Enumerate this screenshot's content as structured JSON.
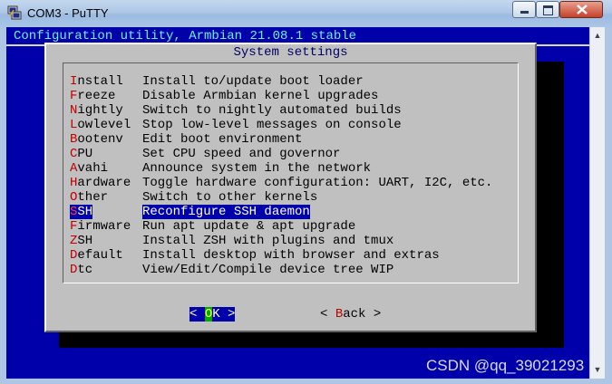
{
  "window": {
    "title": "COM3 - PuTTY",
    "icon": "putty-icon",
    "controls": [
      "minimize-icon",
      "maximize-icon",
      "close-icon"
    ]
  },
  "terminal": {
    "header": "Configuration utility, Armbian 21.08.1 stable",
    "background_color": "#0000aa"
  },
  "dialog": {
    "title": "System settings",
    "selected_index": 9,
    "items": [
      {
        "hk": "I",
        "rest": "nstall",
        "desc": "Install to/update boot loader"
      },
      {
        "hk": "F",
        "rest": "reeze",
        "desc": "Disable Armbian kernel upgrades"
      },
      {
        "hk": "N",
        "rest": "ightly",
        "desc": "Switch to nightly automated builds"
      },
      {
        "hk": "L",
        "rest": "owlevel",
        "desc": "Stop low-level messages on console"
      },
      {
        "hk": "B",
        "rest": "ootenv",
        "desc": "Edit boot environment"
      },
      {
        "hk": "C",
        "rest": "PU",
        "desc": "Set CPU speed and governor"
      },
      {
        "hk": "A",
        "rest": "vahi",
        "desc": "Announce system in the network"
      },
      {
        "hk": "H",
        "rest": "ardware",
        "desc": "Toggle hardware configuration: UART, I2C, etc."
      },
      {
        "hk": "O",
        "rest": "ther",
        "desc": "Switch to other kernels"
      },
      {
        "hk": "S",
        "rest": "SH",
        "desc": "Reconfigure SSH daemon"
      },
      {
        "hk": "F",
        "rest": "irmware",
        "desc": "Run apt update & apt upgrade"
      },
      {
        "hk": "Z",
        "rest": "SH",
        "desc": "Install ZSH with plugins and tmux"
      },
      {
        "hk": "D",
        "rest": "efault",
        "desc": "Install desktop with browser and extras"
      },
      {
        "hk": "D",
        "rest": "tc",
        "desc": "View/Edit/Compile device tree WIP"
      }
    ],
    "buttons": {
      "ok": {
        "left": "< ",
        "hk": "O",
        "rest": "K",
        "right": " >"
      },
      "back": {
        "left": "< ",
        "hk": "B",
        "rest": "ack",
        "right": " >"
      }
    }
  },
  "watermark": "CSDN @qq_39021293"
}
